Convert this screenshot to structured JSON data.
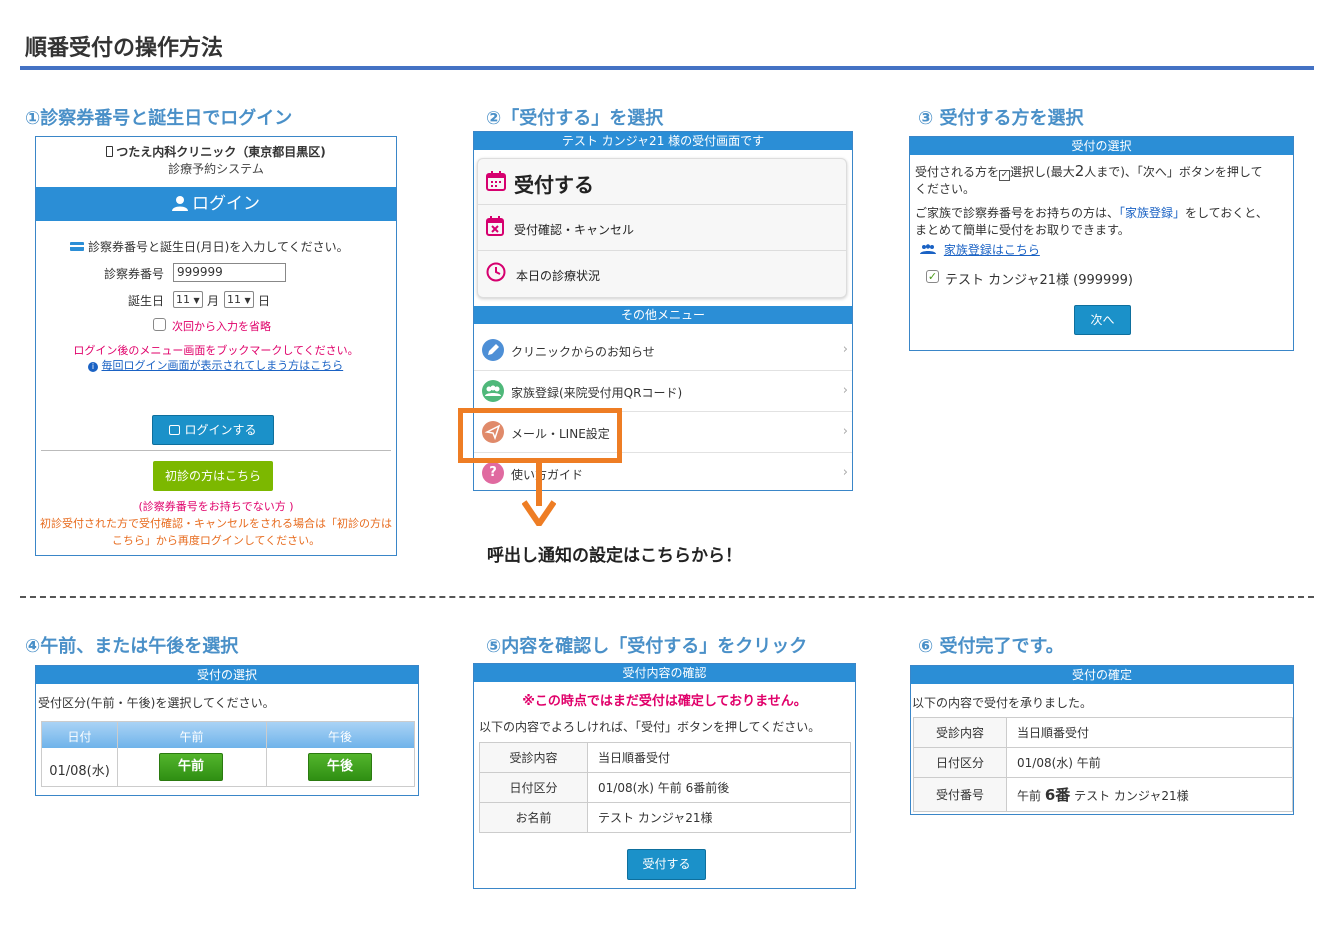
{
  "page": {
    "title": "順番受付の操作方法",
    "steps": [
      "①診察券番号と誕生日でログイン",
      "②「受付する」を選択",
      "③ 受付する方を選択",
      "④午前、または午後を選択",
      "⑤内容を確認し「受付する」をクリック",
      "⑥ 受付完了です。"
    ]
  },
  "login": {
    "clinic": "つたえ内科クリニック（東京都目黒区)",
    "system": "診療予約システム",
    "header": "ログイン",
    "instruction": "診察券番号と誕生日(月日)を入力してください。",
    "card_label": "診察券番号",
    "card_value": "999999",
    "birth_label": "誕生日",
    "month_value": "11",
    "month_unit": "月",
    "day_value": "11",
    "day_unit": "日",
    "remember_label": "次回から入力を省略",
    "bookmark_note": "ログイン後のメニュー画面をブックマークしてください。",
    "help_link": "毎回ログイン画面が表示されてしまう方はこちら",
    "login_button": "ログインする",
    "first_visit_button": "初診の方はこちら",
    "first_visit_note": "(診察券番号をお持ちでない方 )",
    "first_visit_note2": "初診受付された方で受付確認・キャンセルをされる場合は「初診の方は",
    "first_visit_note3": "こちら」から再度ログインしてください。"
  },
  "menu": {
    "header": "テスト カンジャ21 様の受付画面です",
    "reception": "受付する",
    "confirm_cancel": "受付確認・キャンセル",
    "today_status": "本日の診療状況",
    "other_header": "その他メニュー",
    "other_items": [
      "クリニックからのお知らせ",
      "家族登録(来院受付用QRコード)",
      "メール・LINE設定",
      "使い方ガイド"
    ],
    "callout": "呼出し通知の設定はこちらから！"
  },
  "select_person": {
    "header": "受付の選択",
    "text1a": "受付される方を",
    "text1b": "選択し(最大",
    "max_count": "2",
    "text1c": "人まで)、「次へ」ボタンを押して",
    "text1d": "ください。",
    "text2a": "ご家族で診察券番号をお持ちの方は、",
    "text2_link": "「家族登録」",
    "text2b": "をしておくと、",
    "text3": "まとめて簡単に受付をお取りできます。",
    "family_link": "家族登録はこちら",
    "person": "テスト カンジャ21様 (999999)",
    "next_button": "次へ"
  },
  "select_time": {
    "header": "受付の選択",
    "instruction": "受付区分(午前・午後)を選択してください。",
    "col_date": "日付",
    "col_am": "午前",
    "col_pm": "午後",
    "date": "01/08(水)",
    "am_button": "午前",
    "pm_button": "午後"
  },
  "confirm": {
    "header": "受付内容の確認",
    "warning": "※この時点ではまだ受付は確定しておりません。",
    "instruction": "以下の内容でよろしければ、「受付」ボタンを押してください。",
    "rows": [
      {
        "label": "受診内容",
        "value": "当日順番受付"
      },
      {
        "label": "日付区分",
        "value": "01/08(水) 午前 6番前後"
      },
      {
        "label": "お名前",
        "value": "テスト カンジャ21様"
      }
    ],
    "submit_button": "受付する"
  },
  "complete": {
    "header": "受付の確定",
    "text": "以下の内容で受付を承りました。",
    "label1": "受診内容",
    "value1": "当日順番受付",
    "label2": "日付区分",
    "value2": "01/08(水) 午前",
    "label3": "受付番号",
    "value3a": "午前",
    "value3b": "6番",
    "value3c": "テスト カンジャ21様"
  },
  "colors": {
    "accent": "#2b8ed6",
    "title_blue": "#4a90c8",
    "highlight": "#ee7d24",
    "warning": "#e0006a"
  }
}
